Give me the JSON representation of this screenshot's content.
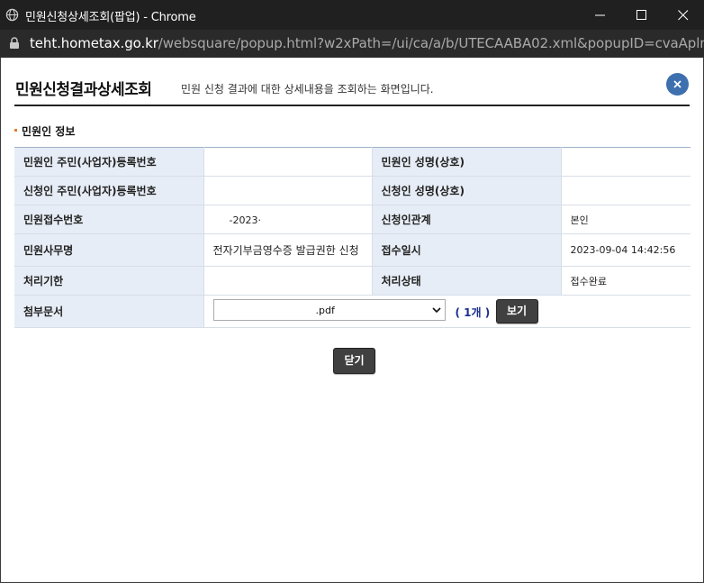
{
  "window": {
    "title": "민원신청상세조회(팝업) - Chrome",
    "url_host": "teht.hometax.go.kr",
    "url_path": "/websquare/popup.html?w2xPath=/ui/ca/a/b/UTECAABA02.xml&popupID=cvaAplnDetailPopU..."
  },
  "header": {
    "title": "민원신청결과상세조회",
    "description": "민원 신청 결과에 대한 상세내용을 조회하는 화면입니다."
  },
  "section": {
    "title": "민원인 정보"
  },
  "table": {
    "row1": {
      "label_a": "민원인 주민(사업자)등록번호",
      "value_a": "",
      "label_b": "민원인 성명(상호)",
      "value_b": ""
    },
    "row2": {
      "label_a": "신청인 주민(사업자)등록번호",
      "value_a": "",
      "label_b": "신청인 성명(상호)",
      "value_b": ""
    },
    "row3": {
      "label_a": "민원접수번호",
      "value_a": "-2023·",
      "label_b": "신청인관계",
      "value_b": "본인"
    },
    "row4": {
      "label_a": "민원사무명",
      "value_a": "전자기부금영수증 발급권한 신청",
      "label_b": "접수일시",
      "value_b": "2023-09-04 14:42:56"
    },
    "row5": {
      "label_a": "처리기한",
      "value_a": "",
      "label_b": "처리상태",
      "value_b": "접수완료"
    },
    "row6": {
      "label_a": "첨부문서",
      "selected_file": ".pdf",
      "file_count": "( 1개 )",
      "view_button": "보기"
    }
  },
  "footer": {
    "close_button": "닫기"
  },
  "colors": {
    "accent": "#3e6fae",
    "header_cell": "#e7edf6",
    "button": "#404040",
    "bullet": "#e37b2f"
  },
  "icons": {
    "window": "globe-icon",
    "secure": "lock-icon",
    "dismiss": "close-icon",
    "dropdown": "chevron-down-icon"
  }
}
